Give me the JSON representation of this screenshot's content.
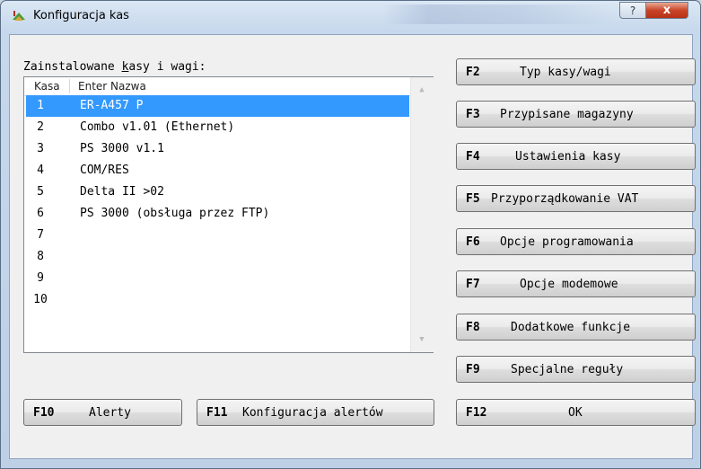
{
  "window": {
    "title": "Konfiguracja kas",
    "help_glyph": "?",
    "close_glyph": "x"
  },
  "list": {
    "label_before": "Zainstalowane ",
    "label_underlined": "k",
    "label_after": "asy i wagi:",
    "columns": [
      "Kasa",
      "Enter Nazwa"
    ],
    "rows": [
      {
        "num": "1",
        "name": "ER-A457 P",
        "selected": true
      },
      {
        "num": "2",
        "name": "Combo v1.01 (Ethernet)"
      },
      {
        "num": "3",
        "name": "PS 3000 v1.1"
      },
      {
        "num": "4",
        "name": "COM/RES"
      },
      {
        "num": "5",
        "name": "Delta II >02"
      },
      {
        "num": "6",
        "name": "PS 3000 (obsługa przez FTP)"
      },
      {
        "num": "7",
        "name": ""
      },
      {
        "num": "8",
        "name": ""
      },
      {
        "num": "9",
        "name": ""
      },
      {
        "num": "10",
        "name": ""
      }
    ]
  },
  "buttons": {
    "f2": {
      "key": "F2",
      "label": "Typ kasy/wagi"
    },
    "f3": {
      "key": "F3",
      "label": "Przypisane magazyny"
    },
    "f4": {
      "key": "F4",
      "label": "Ustawienia kasy"
    },
    "f5": {
      "key": "F5",
      "label": "Przyporządkowanie VAT"
    },
    "f6": {
      "key": "F6",
      "label": "Opcje programowania"
    },
    "f7": {
      "key": "F7",
      "label": "Opcje modemowe"
    },
    "f8": {
      "key": "F8",
      "label": "Dodatkowe funkcje"
    },
    "f9": {
      "key": "F9",
      "label": "Specjalne reguły"
    },
    "f10": {
      "key": "F10",
      "label": "Alerty"
    },
    "f11": {
      "key": "F11",
      "label": "Konfiguracja alertów"
    },
    "f12": {
      "key": "F12",
      "label": "OK"
    }
  },
  "colors": {
    "selection": "#3399ff",
    "close_button": "#c9452a"
  }
}
